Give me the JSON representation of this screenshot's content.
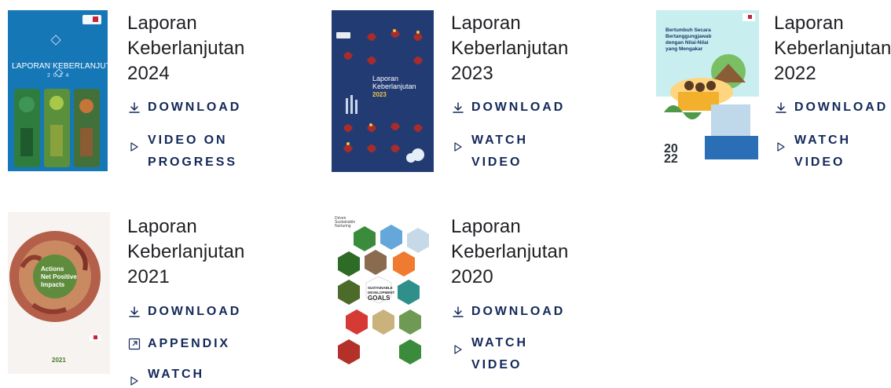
{
  "reports": [
    {
      "title_line1": "Laporan",
      "title_line2": "Keberlanjutan",
      "year": "2024",
      "cover": {
        "heading": "LAPORAN KEBERLANJUTAN",
        "year": "2 0 2 4"
      },
      "actions": [
        {
          "label": "DOWNLOAD",
          "icon": "download-icon"
        },
        {
          "label_lines": [
            "VIDEO ON",
            "PROGRESS"
          ],
          "icon": "play-icon"
        }
      ]
    },
    {
      "title_line1": "Laporan",
      "title_line2": "Keberlanjutan",
      "year": "2023",
      "cover": {
        "heading_line1": "Laporan",
        "heading_line2": "Keberlanjutan",
        "year": "2023"
      },
      "actions": [
        {
          "label": "DOWNLOAD",
          "icon": "download-icon"
        },
        {
          "label_lines": [
            "WATCH",
            "VIDEO"
          ],
          "icon": "play-icon"
        }
      ]
    },
    {
      "title_line1": "Laporan",
      "title_line2": "Keberlanjutan",
      "year": "2022",
      "cover": {
        "tagline_line1": "Bertumbuh Secara",
        "tagline_line2": "Bertanggungjawab",
        "tagline_line3": "dengan Nilai-Nilai",
        "tagline_line4": "yang Mengakar",
        "year_top": "20",
        "year_bottom": "22"
      },
      "actions": [
        {
          "label": "DOWNLOAD",
          "icon": "download-icon"
        },
        {
          "label_lines": [
            "WATCH",
            "VIDEO"
          ],
          "icon": "play-icon"
        }
      ]
    },
    {
      "title_line1": "Laporan",
      "title_line2": "Keberlanjutan",
      "year": "2021",
      "cover": {
        "circle_line1": "Actions",
        "circle_line2": "Net Positive",
        "circle_line3": "Impacts",
        "year": "2021"
      },
      "actions": [
        {
          "label": "DOWNLOAD",
          "icon": "download-icon"
        },
        {
          "label": "APPENDIX",
          "icon": "external-link-icon"
        },
        {
          "label": "WATCH",
          "icon": "play-icon"
        }
      ]
    },
    {
      "title_line1": "Laporan",
      "title_line2": "Keberlanjutan",
      "year": "2020",
      "cover": {
        "top_line1": "Driven",
        "top_line2": "Sustainable",
        "top_line3": "Nurturing",
        "goals_line1": "SUSTAINABLE",
        "goals_line2": "DEVELOPMENT",
        "goals_line3": "GOALS"
      },
      "actions": [
        {
          "label": "DOWNLOAD",
          "icon": "download-icon"
        },
        {
          "label_lines": [
            "WATCH",
            "VIDEO"
          ],
          "icon": "play-icon"
        }
      ]
    }
  ],
  "colors": {
    "accent": "#14295a",
    "title": "#1f1f24",
    "cover_2024_bg": "#1677b7",
    "cover_2023_bg": "#223c73",
    "cover_2022_bg": "#ffffff"
  }
}
